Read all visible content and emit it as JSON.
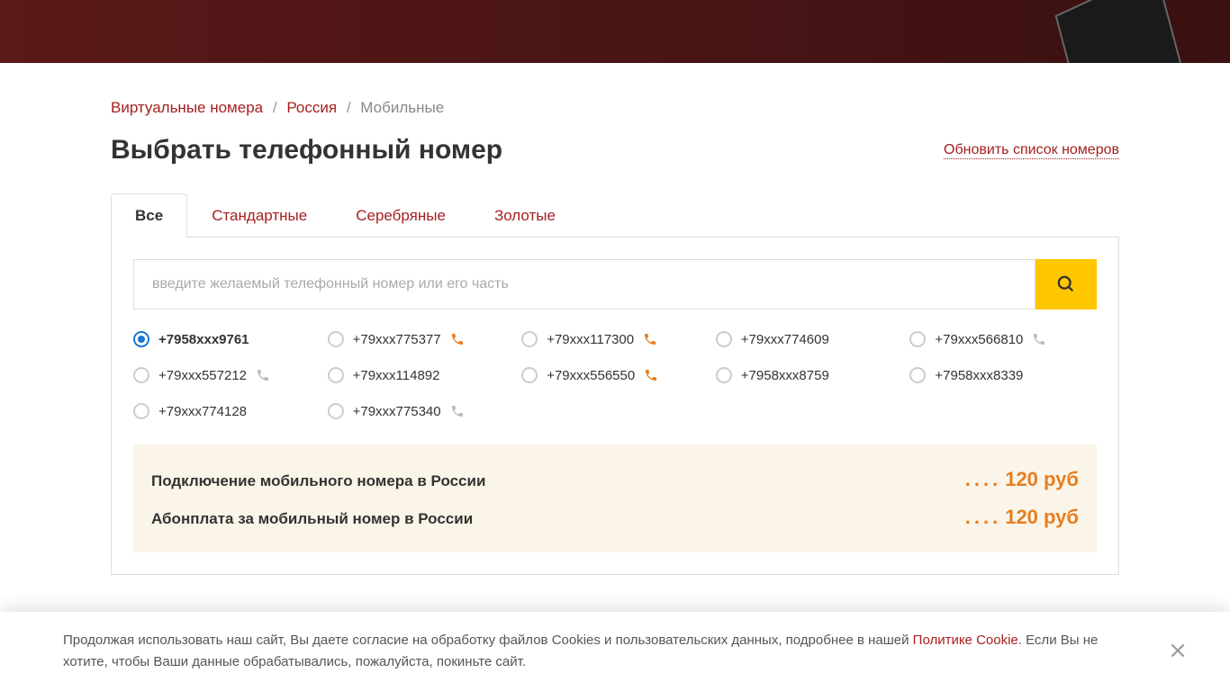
{
  "breadcrumb": {
    "items": [
      {
        "label": "Виртуальные номера",
        "link": true
      },
      {
        "label": "Россия",
        "link": true
      },
      {
        "label": "Мобильные",
        "link": false
      }
    ]
  },
  "page": {
    "title": "Выбрать телефонный номер",
    "refresh": "Обновить список номеров"
  },
  "tabs": [
    {
      "label": "Все",
      "active": true
    },
    {
      "label": "Стандартные",
      "active": false
    },
    {
      "label": "Серебряные",
      "active": false
    },
    {
      "label": "Золотые",
      "active": false
    }
  ],
  "search": {
    "placeholder": "введите желаемый телефонный номер или его часть"
  },
  "numbers": [
    {
      "num": "+7958xxx9761",
      "selected": true,
      "icon": null
    },
    {
      "num": "+79xxx775377",
      "selected": false,
      "icon": "orange"
    },
    {
      "num": "+79xxx117300",
      "selected": false,
      "icon": "orange"
    },
    {
      "num": "+79xxx774609",
      "selected": false,
      "icon": null
    },
    {
      "num": "+79xxx566810",
      "selected": false,
      "icon": "grey"
    },
    {
      "num": "+79xxx557212",
      "selected": false,
      "icon": "grey"
    },
    {
      "num": "+79xxx114892",
      "selected": false,
      "icon": null
    },
    {
      "num": "+79xxx556550",
      "selected": false,
      "icon": "orange"
    },
    {
      "num": "+7958xxx8759",
      "selected": false,
      "icon": null
    },
    {
      "num": "+7958xxx8339",
      "selected": false,
      "icon": null
    },
    {
      "num": "+79xxx774128",
      "selected": false,
      "icon": null
    },
    {
      "num": "+79xxx775340",
      "selected": false,
      "icon": "grey"
    }
  ],
  "pricing": [
    {
      "label": "Подключение мобильного номера в России",
      "value": "120 руб"
    },
    {
      "label": "Абонплата за мобильный номер в России",
      "value": "120 руб"
    }
  ],
  "cookie": {
    "text_prefix": "Продолжая использовать наш сайт, Вы даете согласие на обработку файлов Cookies и пользовательских данных, подробнее в нашей ",
    "link": "Политике Cookie",
    "text_suffix": ". Если Вы не хотите, чтобы Ваши данные обрабатывались, пожалуйста, покиньте сайт."
  },
  "colors": {
    "accent": "#a52020",
    "highlight": "#e67e22",
    "search_btn": "#ffc700"
  }
}
